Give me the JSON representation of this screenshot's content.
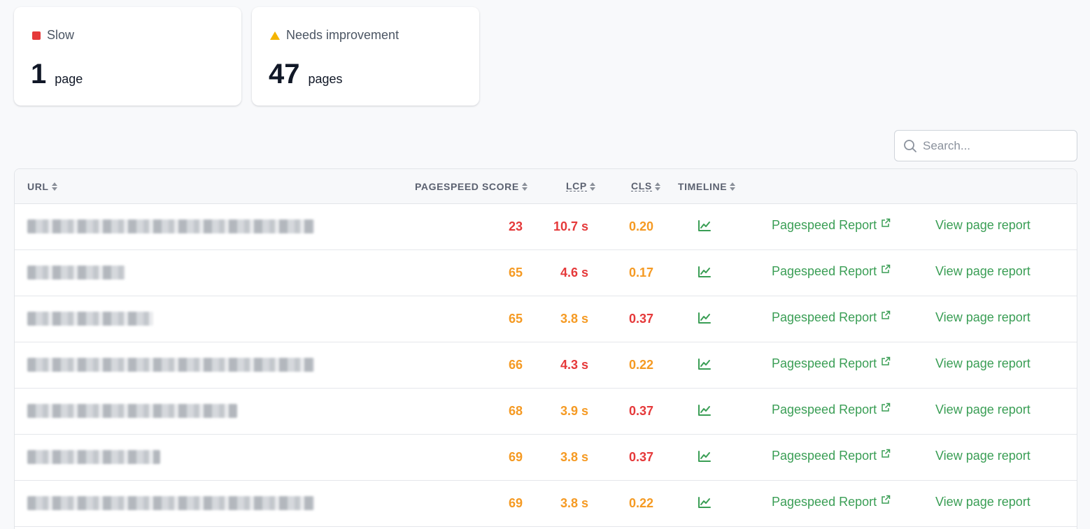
{
  "summary": {
    "slow": {
      "label": "Slow",
      "count": "1",
      "unit": "page",
      "color": "#e5393a"
    },
    "needs_improvement": {
      "label": "Needs improvement",
      "count": "47",
      "unit": "pages",
      "color": "#f4b400"
    }
  },
  "search": {
    "placeholder": "Search...",
    "icon": "search-icon"
  },
  "table": {
    "columns": [
      "URL",
      "PAGESPEED SCORE",
      "LCP",
      "CLS",
      "TIMELINE"
    ],
    "rows": [
      {
        "score": "23",
        "score_status": "red",
        "lcp": "10.7 s",
        "lcp_status": "red",
        "cls": "0.20",
        "cls_status": "orange",
        "link": "Pagespeed Report",
        "action": "View page report"
      },
      {
        "score": "65",
        "score_status": "orange",
        "lcp": "4.6 s",
        "lcp_status": "red",
        "cls": "0.17",
        "cls_status": "orange",
        "link": "Pagespeed Report",
        "action": "View page report"
      },
      {
        "score": "65",
        "score_status": "orange",
        "lcp": "3.8 s",
        "lcp_status": "orange",
        "cls": "0.37",
        "cls_status": "red",
        "link": "Pagespeed Report",
        "action": "View page report"
      },
      {
        "score": "66",
        "score_status": "orange",
        "lcp": "4.3 s",
        "lcp_status": "red",
        "cls": "0.22",
        "cls_status": "orange",
        "link": "Pagespeed Report",
        "action": "View page report"
      },
      {
        "score": "68",
        "score_status": "orange",
        "lcp": "3.9 s",
        "lcp_status": "orange",
        "cls": "0.37",
        "cls_status": "red",
        "link": "Pagespeed Report",
        "action": "View page report"
      },
      {
        "score": "69",
        "score_status": "orange",
        "lcp": "3.8 s",
        "lcp_status": "orange",
        "cls": "0.37",
        "cls_status": "red",
        "link": "Pagespeed Report",
        "action": "View page report"
      },
      {
        "score": "69",
        "score_status": "orange",
        "lcp": "3.8 s",
        "lcp_status": "orange",
        "cls": "0.22",
        "cls_status": "orange",
        "link": "Pagespeed Report",
        "action": "View page report"
      }
    ]
  },
  "colors": {
    "red": "#e5393a",
    "orange": "#f59a23",
    "green": "#3a9e55",
    "yellow": "#f4b400"
  },
  "icons": {
    "timeline": "line-chart-icon",
    "external": "external-link-icon"
  }
}
